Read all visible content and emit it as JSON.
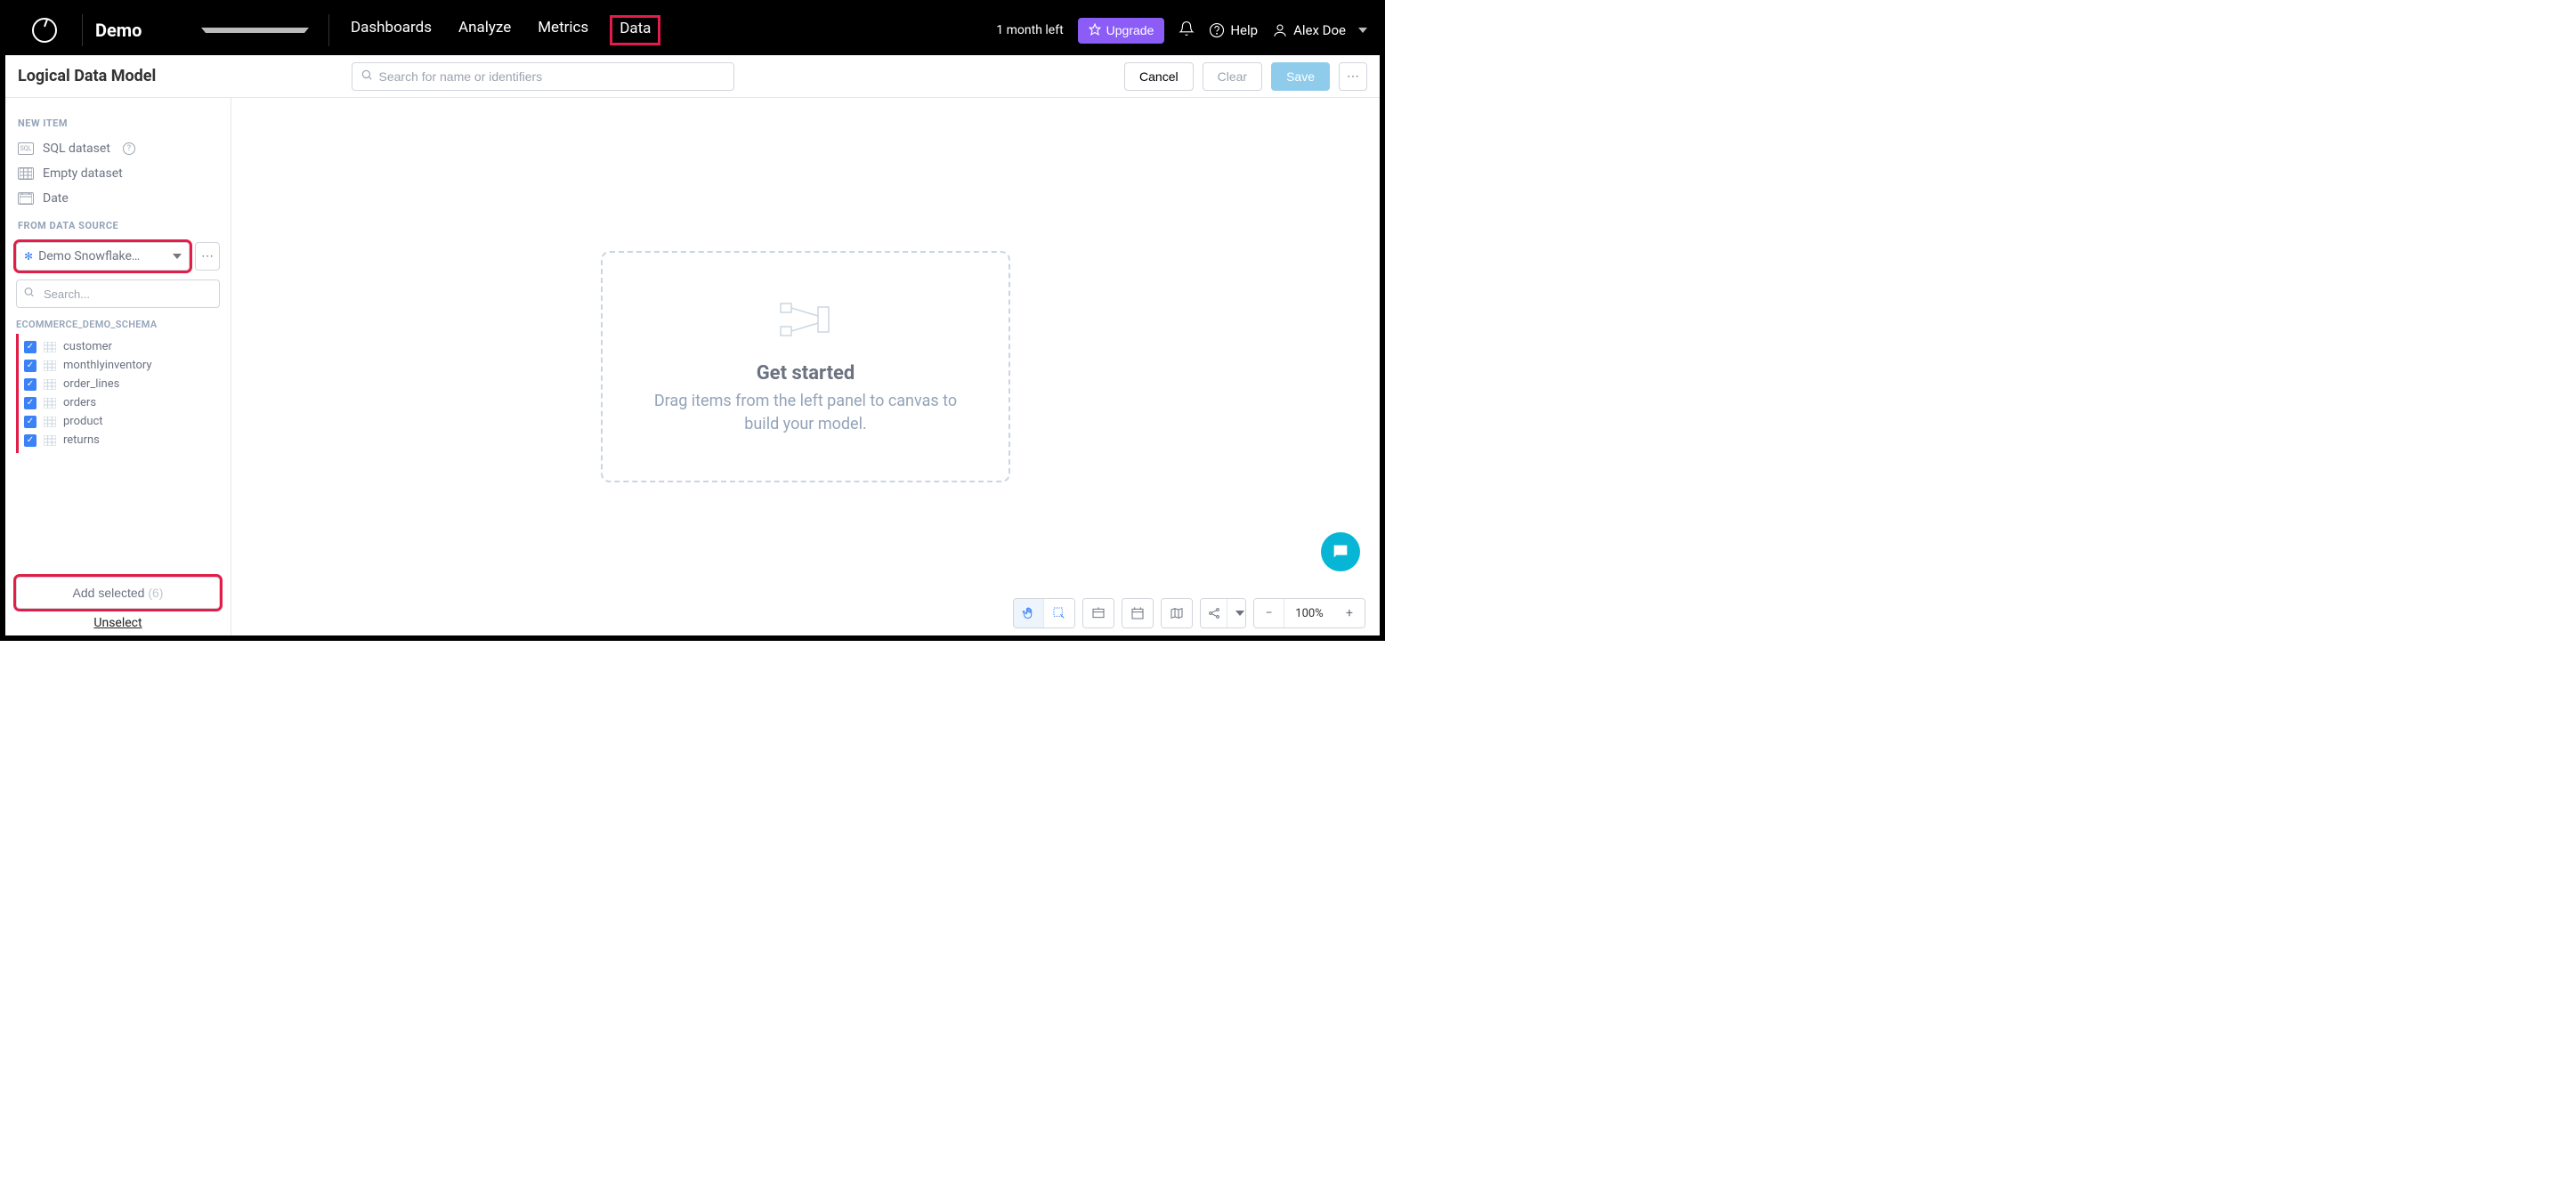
{
  "topbar": {
    "workspace_name": "Demo",
    "nav": [
      {
        "label": "Dashboards",
        "active": false
      },
      {
        "label": "Analyze",
        "active": false
      },
      {
        "label": "Metrics",
        "active": false
      },
      {
        "label": "Data",
        "active": true
      }
    ],
    "trial_text": "1 month left",
    "upgrade_label": "Upgrade",
    "help_label": "Help",
    "user_name": "Alex Doe"
  },
  "subbar": {
    "title": "Logical Data Model",
    "search_placeholder": "Search for name or identifiers",
    "cancel_label": "Cancel",
    "clear_label": "Clear",
    "save_label": "Save"
  },
  "sidebar": {
    "sections": {
      "new_item_title": "NEW ITEM",
      "from_ds_title": "FROM DATA SOURCE"
    },
    "new_items": [
      {
        "label": "SQL dataset",
        "has_help": true,
        "icon": "sql"
      },
      {
        "label": "Empty dataset",
        "has_help": false,
        "icon": "grid"
      },
      {
        "label": "Date",
        "has_help": false,
        "icon": "calendar"
      }
    ],
    "datasource_selected": "Demo Snowflake…",
    "side_search_placeholder": "Search...",
    "schema_name": "ECOMMERCE_DEMO_SCHEMA",
    "tables": [
      {
        "name": "customer",
        "checked": true
      },
      {
        "name": "monthlyinventory",
        "checked": true
      },
      {
        "name": "order_lines",
        "checked": true
      },
      {
        "name": "orders",
        "checked": true
      },
      {
        "name": "product",
        "checked": true
      },
      {
        "name": "returns",
        "checked": true
      }
    ],
    "add_selected_label": "Add selected",
    "add_selected_count": "(6)",
    "unselect_label": "Unselect"
  },
  "canvas": {
    "title": "Get started",
    "subtitle": "Drag items from the left panel to canvas to build your model."
  },
  "bottom_toolbar": {
    "zoom_value": "100%"
  }
}
